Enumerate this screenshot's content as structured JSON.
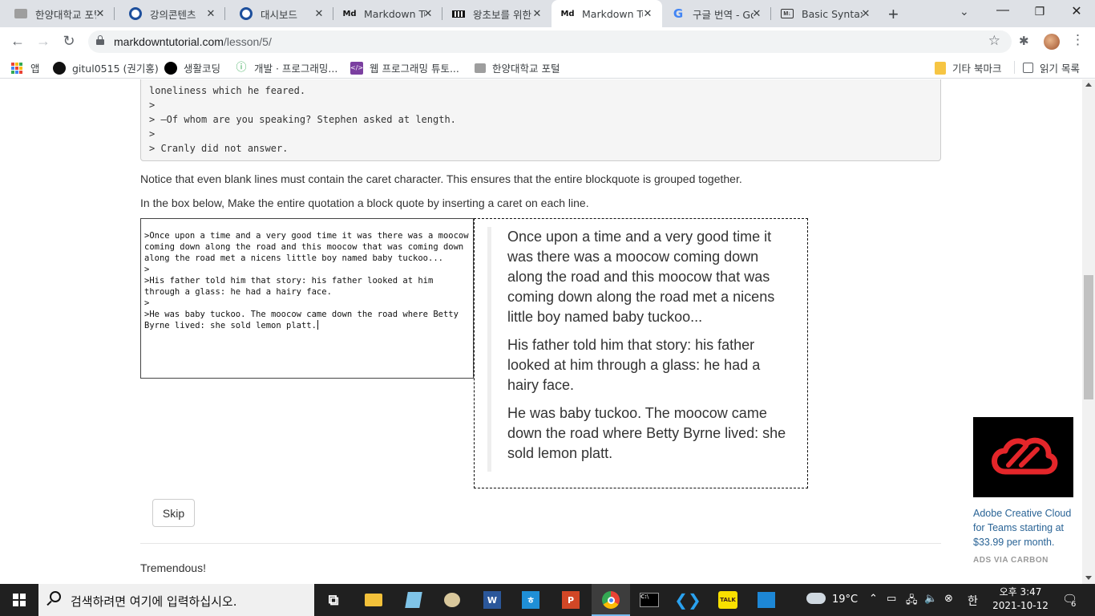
{
  "browser": {
    "tabs": [
      {
        "title": "한양대학교 포털",
        "favicon": "hanyang-icon",
        "active": false
      },
      {
        "title": "강의콘텐츠",
        "favicon": "lms-icon",
        "active": false
      },
      {
        "title": "대시보드",
        "favicon": "lms-icon",
        "active": false
      },
      {
        "title": "Markdown Tutorial",
        "favicon": "md-icon",
        "active": false
      },
      {
        "title": "왕초보를 위한",
        "favicon": "piano-icon",
        "active": false
      },
      {
        "title": "Markdown Tutorial",
        "favicon": "md-icon",
        "active": true
      },
      {
        "title": "구글 번역 - Google",
        "favicon": "google-icon",
        "active": false
      },
      {
        "title": "Basic Syntax",
        "favicon": "markdown-guide-icon",
        "active": false
      }
    ],
    "url_host": "markdowntutorial.com",
    "url_path": "/lesson/5/",
    "bookmarks": [
      {
        "label": "앱",
        "icon": "apps-grid-icon"
      },
      {
        "label": "gitul0515 (권기홍)",
        "icon": "github-icon"
      },
      {
        "label": "생활코딩",
        "icon": "circle-icon"
      },
      {
        "label": "개발 · 프로그래밍...",
        "icon": "leaf-icon"
      },
      {
        "label": "웹 프로그래밍 튜토...",
        "icon": "code-icon"
      },
      {
        "label": "한양대학교 포털",
        "icon": "hanyang-icon"
      }
    ],
    "other_bookmarks": "기타 북마크",
    "reading_list": "읽기 목록"
  },
  "content": {
    "code_lines": [
      "loneliness which he feared.",
      ">",
      "> —Of whom are you speaking? Stephen asked at length.",
      ">",
      "> Cranly did not answer."
    ],
    "notice": "Notice that even blank lines must contain the caret character. This ensures that the entire blockquote is grouped together.",
    "instruction": "In the box below, Make the entire quotation a block quote by inserting a caret on each line.",
    "editor_lines": [
      ">Once upon a time and a very good time it was there was a moocow coming down along the road and this moocow that was coming down along the road met a nicens little boy named baby tuckoo...",
      ">",
      ">His father told him that story: his father looked at him through a glass: he had a hairy face.",
      ">",
      ">He was baby tuckoo. The moocow came down the road where Betty Byrne lived: she sold lemon platt."
    ],
    "preview_paragraphs": [
      "Once upon a time and a very good time it was there was a moocow coming down along the road and this moocow that was coming down along the road met a nicens little boy named baby tuckoo...",
      "His father told him that story: his father looked at him through a glass: he had a hairy face.",
      "He was baby tuckoo. The moocow came down the road where Betty Byrne lived: she sold lemon platt."
    ],
    "skip_label": "Skip",
    "result": "Tremendous!"
  },
  "ad": {
    "text": "Adobe Creative Cloud for Teams starting at $33.99 per month.",
    "via": "ADS VIA CARBON",
    "brand_color": "#e4262a"
  },
  "taskbar": {
    "search_placeholder": "검색하려면 여기에 입력하십시오.",
    "weather": "19°C",
    "ime": "한",
    "time": "오후 3:47",
    "date": "2021-10-12",
    "notifications": "6"
  },
  "colors": {
    "tab_strip": "#dee1e6",
    "link": "#2a6496",
    "taskbar": "#202020"
  }
}
